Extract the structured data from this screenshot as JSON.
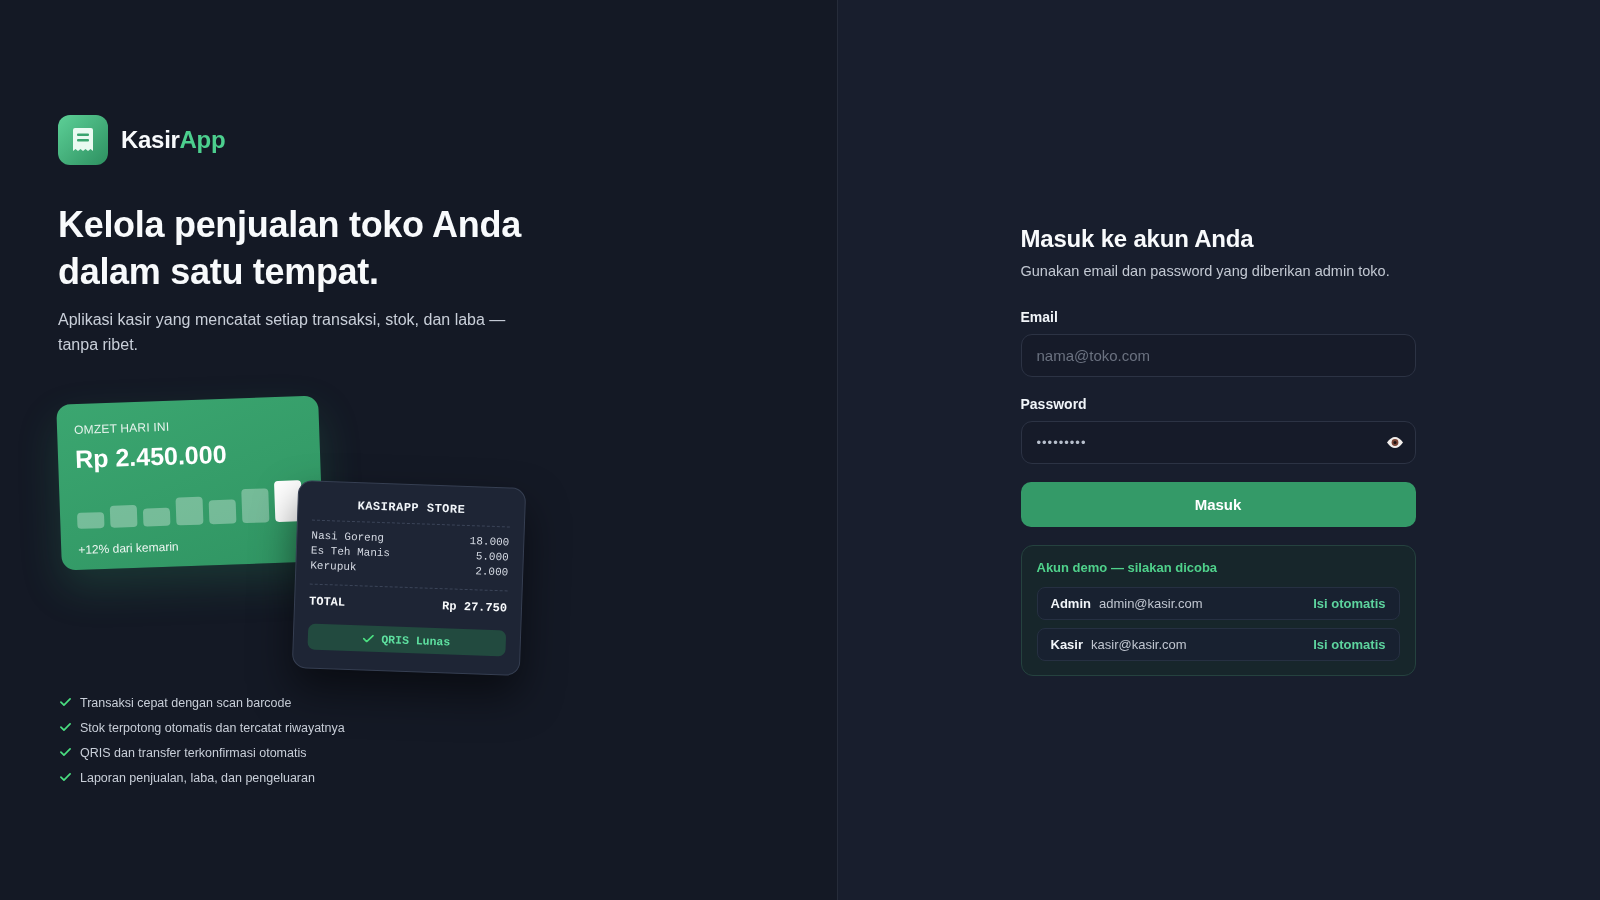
{
  "brand": {
    "name": "Kasir",
    "accent": "App"
  },
  "hero": {
    "title": "Kelola penjualan toko Anda dalam satu tempat.",
    "subtitle": "Aplikasi kasir yang mencatat setiap transaksi, stok, dan laba — tanpa ribet."
  },
  "sales_card": {
    "label": "OMZET HARI INI",
    "amount": "Rp 2.450.000",
    "change": "+12% dari kemarin"
  },
  "receipt": {
    "title": "KASIRAPP STORE",
    "items": [
      {
        "name": "Nasi Goreng",
        "price": "18.000"
      },
      {
        "name": "Es Teh Manis",
        "price": "5.000"
      },
      {
        "name": "Kerupuk",
        "price": "2.000"
      }
    ],
    "total_label": "TOTAL",
    "total": "Rp 27.750",
    "status": "QRIS Lunas"
  },
  "features": [
    "Transaksi cepat dengan scan barcode",
    "Stok terpotong otomatis dan tercatat riwayatnya",
    "QRIS dan transfer terkonfirmasi otomatis",
    "Laporan penjualan, laba, dan pengeluaran"
  ],
  "login": {
    "title": "Masuk ke akun Anda",
    "subtitle": "Gunakan email dan password yang diberikan admin toko.",
    "fields": [
      {
        "kind": "email",
        "label": "Email",
        "placeholder": "nama@toko.com"
      },
      {
        "kind": "password",
        "label": "Password",
        "value": "•••••••••"
      }
    ],
    "submit": "Masuk"
  },
  "demo": {
    "title": "Akun demo — silakan dicoba",
    "accounts": [
      {
        "role": "Admin",
        "email": "admin@kasir.com",
        "action": "Isi otomatis"
      },
      {
        "role": "Kasir",
        "email": "kasir@kasir.com",
        "action": "Isi otomatis"
      }
    ]
  }
}
